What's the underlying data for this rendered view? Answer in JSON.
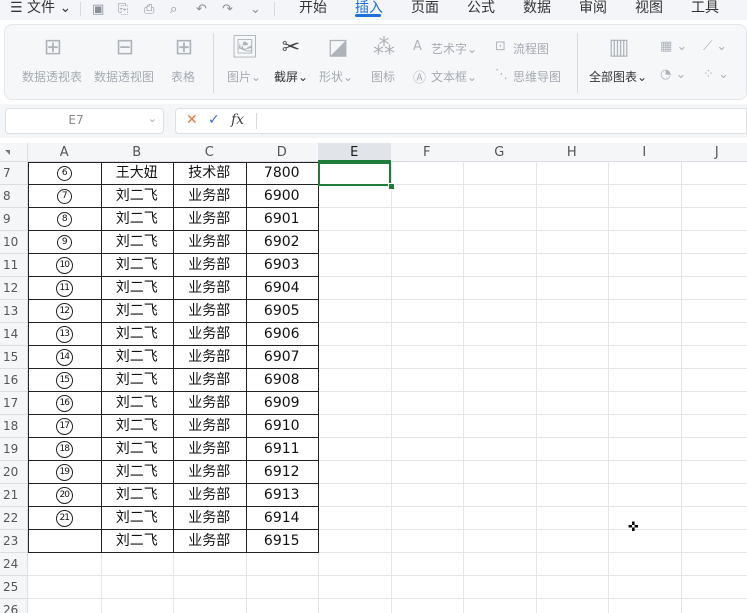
{
  "menubar": {
    "file_label": "文件",
    "tabs": [
      "开始",
      "插入",
      "页面",
      "公式",
      "数据",
      "审阅",
      "视图",
      "工具"
    ],
    "active_tab": "插入"
  },
  "ribbon": {
    "pivot_table": "数据透视表",
    "pivot_chart": "数据透视图",
    "table": "表格",
    "picture": "图片",
    "screenshot": "截屏",
    "shape": "形状",
    "icon": "图标",
    "wordart": "艺术字",
    "flowchart": "流程图",
    "textbox": "文本框",
    "mindmap": "思维导图",
    "all_charts": "全部图表"
  },
  "formula_bar": {
    "name_box": "E7",
    "fx_label": "fx",
    "value": ""
  },
  "grid": {
    "columns": [
      "A",
      "B",
      "C",
      "D",
      "E",
      "F",
      "G",
      "H",
      "I",
      "J"
    ],
    "selected_column": "E",
    "rows": [
      {
        "n": "7",
        "a": "6",
        "b": "王大妞",
        "c": "技术部",
        "d": "7800"
      },
      {
        "n": "8",
        "a": "7",
        "b": "刘二飞",
        "c": "业务部",
        "d": "6900"
      },
      {
        "n": "9",
        "a": "8",
        "b": "刘二飞",
        "c": "业务部",
        "d": "6901"
      },
      {
        "n": "10",
        "a": "9",
        "b": "刘二飞",
        "c": "业务部",
        "d": "6902"
      },
      {
        "n": "11",
        "a": "10",
        "b": "刘二飞",
        "c": "业务部",
        "d": "6903"
      },
      {
        "n": "12",
        "a": "11",
        "b": "刘二飞",
        "c": "业务部",
        "d": "6904"
      },
      {
        "n": "13",
        "a": "12",
        "b": "刘二飞",
        "c": "业务部",
        "d": "6905"
      },
      {
        "n": "14",
        "a": "13",
        "b": "刘二飞",
        "c": "业务部",
        "d": "6906"
      },
      {
        "n": "15",
        "a": "14",
        "b": "刘二飞",
        "c": "业务部",
        "d": "6907"
      },
      {
        "n": "16",
        "a": "15",
        "b": "刘二飞",
        "c": "业务部",
        "d": "6908"
      },
      {
        "n": "17",
        "a": "16",
        "b": "刘二飞",
        "c": "业务部",
        "d": "6909"
      },
      {
        "n": "18",
        "a": "17",
        "b": "刘二飞",
        "c": "业务部",
        "d": "6910"
      },
      {
        "n": "19",
        "a": "18",
        "b": "刘二飞",
        "c": "业务部",
        "d": "6911"
      },
      {
        "n": "20",
        "a": "19",
        "b": "刘二飞",
        "c": "业务部",
        "d": "6912"
      },
      {
        "n": "21",
        "a": "20",
        "b": "刘二飞",
        "c": "业务部",
        "d": "6913"
      },
      {
        "n": "22",
        "a": "21",
        "b": "刘二飞",
        "c": "业务部",
        "d": "6914"
      },
      {
        "n": "23",
        "a": "",
        "b": "刘二飞",
        "c": "业务部",
        "d": "6915"
      },
      {
        "n": "24",
        "a": "",
        "b": "",
        "c": "",
        "d": ""
      },
      {
        "n": "25",
        "a": "",
        "b": "",
        "c": "",
        "d": ""
      },
      {
        "n": "26",
        "a": "",
        "b": "",
        "c": "",
        "d": ""
      }
    ]
  },
  "colors": {
    "accent": "#1f6fd6",
    "selection": "#1e7d3b"
  }
}
